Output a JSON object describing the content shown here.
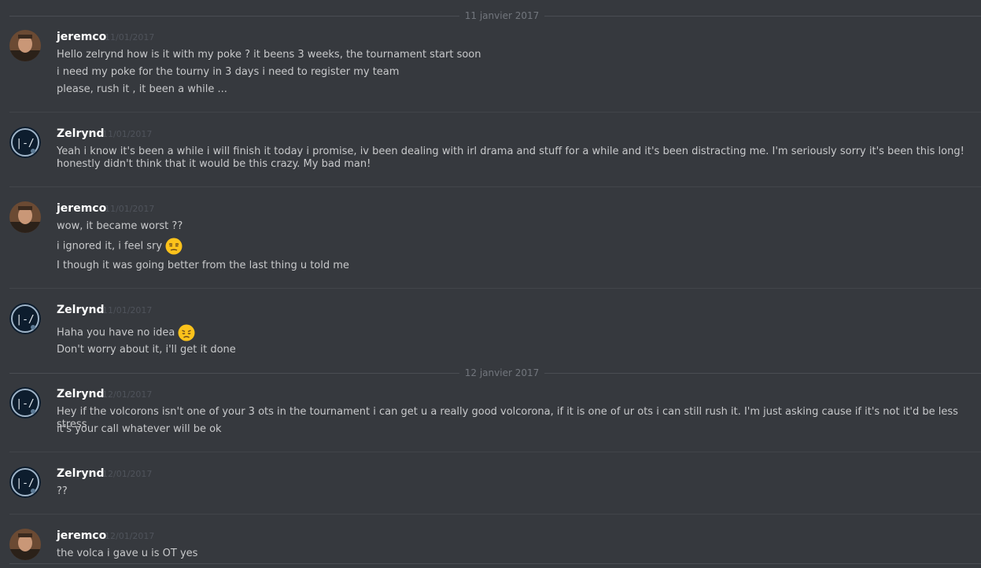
{
  "dates": [
    "11 janvier 2017",
    "12 janvier 2017"
  ],
  "messages": [
    {
      "author": "jeremco",
      "timestamp": "11/01/2017",
      "lines": [
        "Hello zelrynd how is it with my poke ? it beens 3 weeks, the tournament start soon",
        "i need my poke for the tourny in 3 days i need to register my team",
        "please, rush it , it been a while ..."
      ]
    },
    {
      "author": "Zelrynd",
      "timestamp": "11/01/2017",
      "lines": [
        "Yeah i know it's been a while i will finish it today i promise, iv been dealing with irl drama and stuff for a while and it's been distracting me. I'm seriously sorry it's been this long! I",
        "honestly didn't think that it would be this crazy. My bad man!"
      ]
    },
    {
      "author": "jeremco",
      "timestamp": "11/01/2017",
      "lines": [
        "wow, it became worst ??",
        "i ignored it, i feel sry",
        "I though it was going better from the last thing u told me"
      ],
      "emoji": {
        "line": 1,
        "name": "unamused-face-icon"
      }
    },
    {
      "author": "Zelrynd",
      "timestamp": "11/01/2017",
      "lines": [
        "Haha you have no idea",
        "Don't worry about it, i'll get it done"
      ],
      "emoji": {
        "line": 0,
        "name": "disappointed-face-icon"
      }
    },
    {
      "author": "Zelrynd",
      "timestamp": "12/01/2017",
      "lines": [
        "Hey if the volcorons isn't one of your 3 ots in the tournament i can get u a really good volcorona, if it is one of ur ots i can still rush it. I'm just asking cause if it's not it'd be less stress",
        "it's your call whatever will be ok"
      ]
    },
    {
      "author": "Zelrynd",
      "timestamp": "12/01/2017",
      "lines": [
        "??"
      ]
    },
    {
      "author": "jeremco",
      "timestamp": "12/01/2017",
      "lines": [
        "the volca i gave u is OT yes"
      ]
    }
  ],
  "colors": {
    "background": "#36393e",
    "username": "#ffffff",
    "text": "#c8c9cb",
    "timestamp": "#4f535b",
    "emoji": "#fcc21b"
  }
}
